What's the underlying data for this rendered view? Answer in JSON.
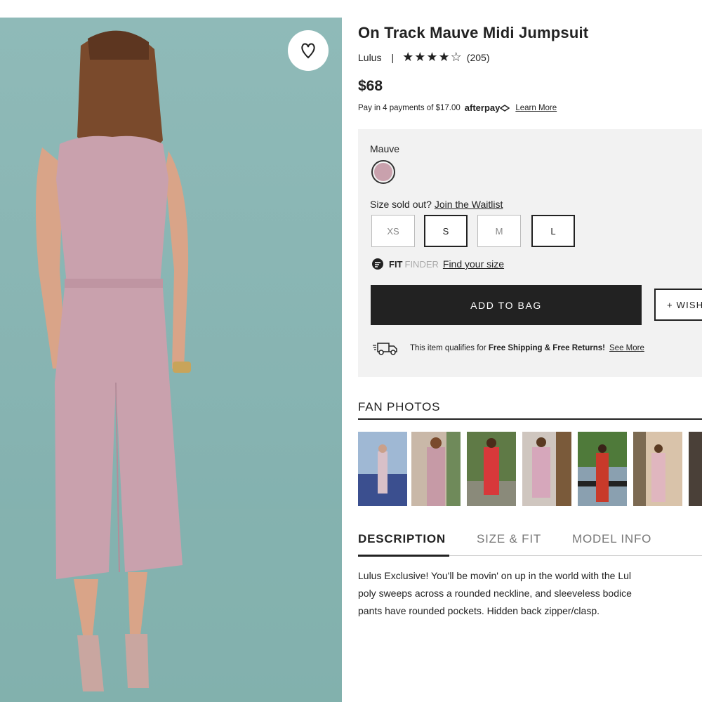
{
  "product": {
    "title": "On Track Mauve Midi Jumpsuit",
    "brand": "Lulus",
    "separator": "|",
    "stars": "★★★★☆",
    "rating": 4,
    "review_count": "(205)",
    "price": "$68",
    "installments": "Pay in 4 payments of $17.00",
    "afterpay_logo": "afterpay",
    "afterpay_icon": "afterpay-arrows-icon",
    "learn_more": "Learn More"
  },
  "options": {
    "color_label": "Mauve",
    "color_hex": "#c9a1ad",
    "size_question": "Size sold out?",
    "waitlist_link": "Join the Waitlist",
    "sizes": [
      {
        "label": "XS",
        "available": false
      },
      {
        "label": "S",
        "available": true
      },
      {
        "label": "M",
        "available": false
      },
      {
        "label": "L",
        "available": true
      }
    ],
    "fit_bold": "FIT",
    "fit_light": "FINDER",
    "fit_link": "Find your size",
    "add_to_bag": "ADD TO BAG",
    "wishlist": "+ WISH",
    "shipping_text": "This item qualifies for",
    "shipping_bold": "Free Shipping & Free Returns!",
    "see_more": "See More"
  },
  "fan_photos": {
    "heading": "FAN PHOTOS",
    "count_visible": 7
  },
  "tabs": [
    {
      "label": "DESCRIPTION",
      "active": true
    },
    {
      "label": "SIZE & FIT",
      "active": false
    },
    {
      "label": "MODEL INFO",
      "active": false
    }
  ],
  "description": {
    "line1": "Lulus Exclusive! You'll be movin' on up in the world with the Lul",
    "line2": "poly sweeps across a rounded neckline, and sleeveless bodice",
    "line3": "pants have rounded pockets. Hidden back zipper/clasp."
  },
  "colors": {
    "background_photo": "#8fbab8",
    "jumpsuit": "#c9a1ad",
    "button_dark": "#222222",
    "panel_gray": "#f2f2f2"
  }
}
